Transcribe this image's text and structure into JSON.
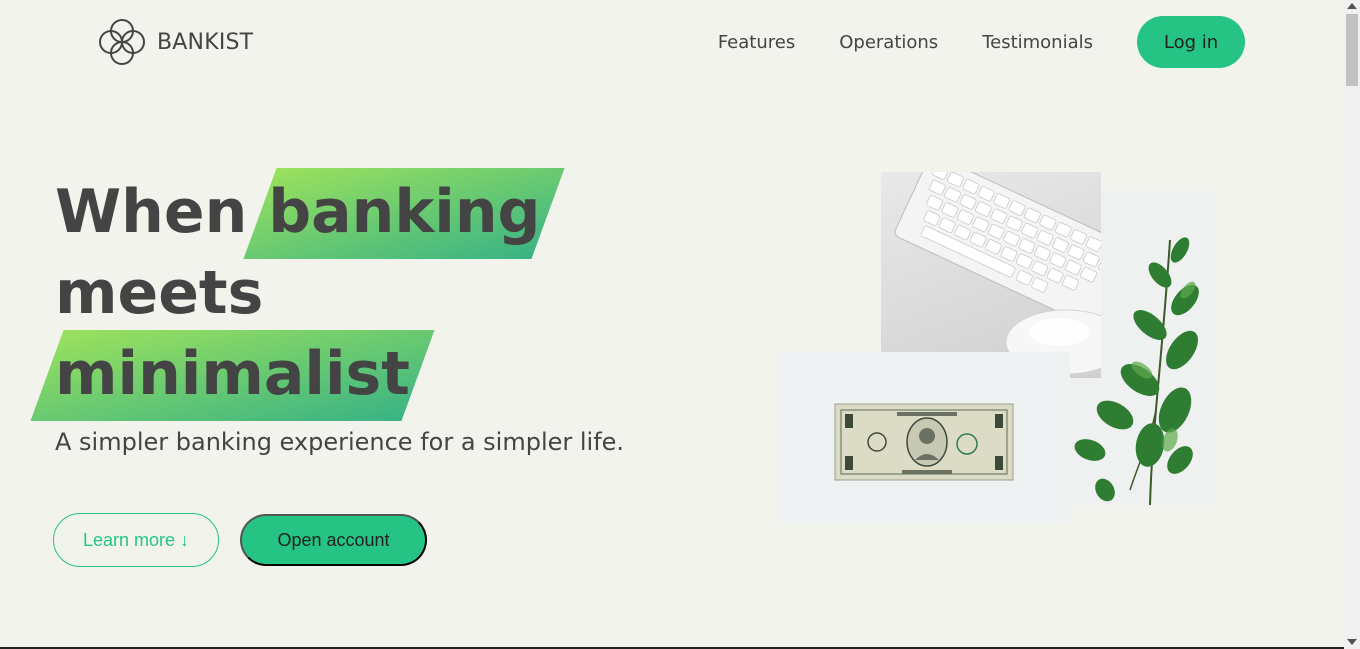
{
  "nav": {
    "logo_text": "BANKIST",
    "links": [
      "Features",
      "Operations",
      "Testimonials"
    ],
    "login_label": "Log in"
  },
  "hero": {
    "title_word_1": "When",
    "title_highlight_1": "banking",
    "title_word_2": "meets",
    "title_highlight_2": "minimalist",
    "subtitle": "A simpler banking experience for a simpler life.",
    "learn_more_label": "Learn more ↓",
    "open_account_label": "Open account"
  },
  "colors": {
    "accent": "#25c484",
    "gradient_start": "#9be15d",
    "gradient_end": "#39b385",
    "background": "#f3f3ee",
    "text": "#444444"
  }
}
